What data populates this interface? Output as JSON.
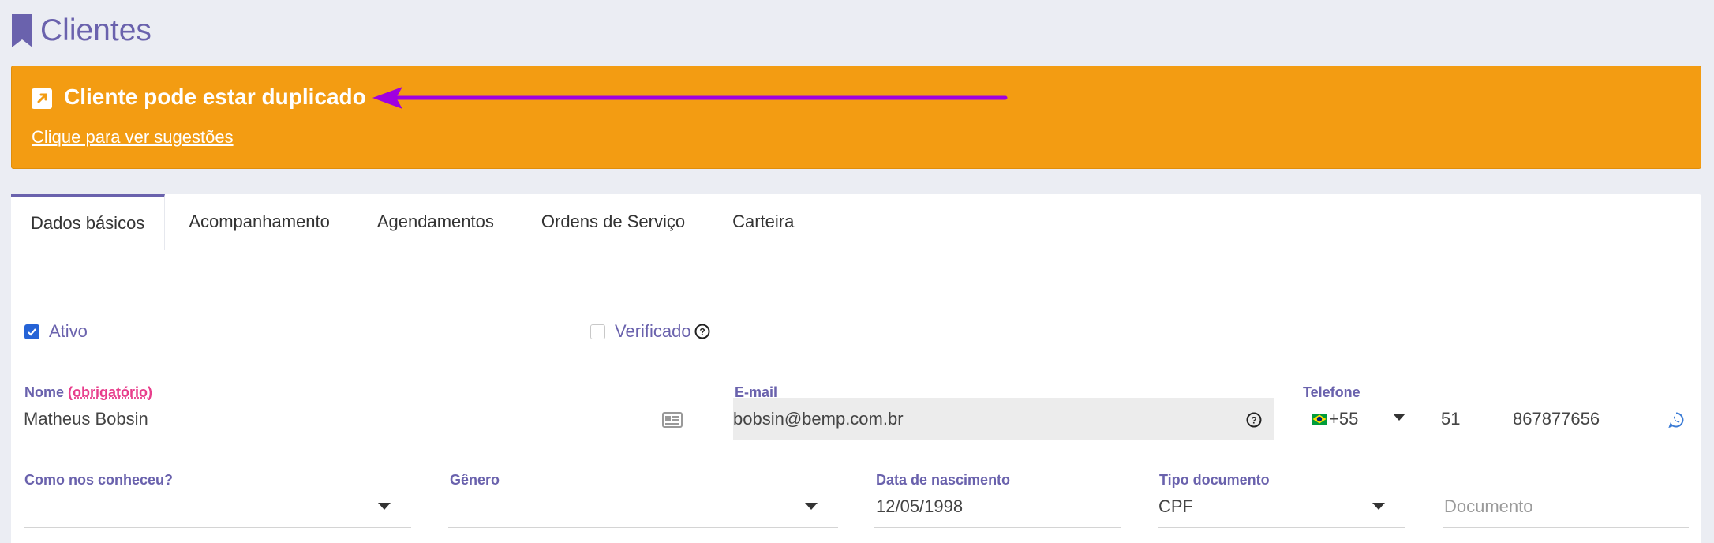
{
  "header": {
    "title": "Clientes",
    "icon": "bookmark-icon",
    "title_color": "#6a62ad"
  },
  "alert": {
    "title": "Cliente pode estar duplicado",
    "link": "Clique para ver sugestões",
    "background": "#f39c12",
    "icon": "external-link-icon"
  },
  "annotation": {
    "icon": "arrow-left-icon",
    "color": "#a000e0"
  },
  "tabs": [
    {
      "label": "Dados básicos",
      "active": true
    },
    {
      "label": "Acompanhamento",
      "active": false
    },
    {
      "label": "Agendamentos",
      "active": false
    },
    {
      "label": "Ordens de Serviço",
      "active": false
    },
    {
      "label": "Carteira",
      "active": false
    }
  ],
  "form": {
    "ativo": {
      "label": "Ativo",
      "checked": true
    },
    "verificado": {
      "label": "Verificado",
      "checked": false
    },
    "nome": {
      "label": "Nome",
      "required": "(obrigatório)",
      "value": "Matheus Bobsin"
    },
    "email": {
      "label": "E-mail",
      "value": "bobsin@bemp.com.br"
    },
    "telefone": {
      "label": "Telefone",
      "country_code": "+55",
      "area_code": "51",
      "number": "867877656"
    },
    "como_conheceu": {
      "label": "Como nos conheceu?",
      "value": ""
    },
    "genero": {
      "label": "Gênero",
      "value": ""
    },
    "nascimento": {
      "label": "Data de nascimento",
      "value": "12/05/1998"
    },
    "tipo_documento": {
      "label": "Tipo documento",
      "value": "CPF"
    },
    "documento": {
      "placeholder": "Documento"
    }
  }
}
